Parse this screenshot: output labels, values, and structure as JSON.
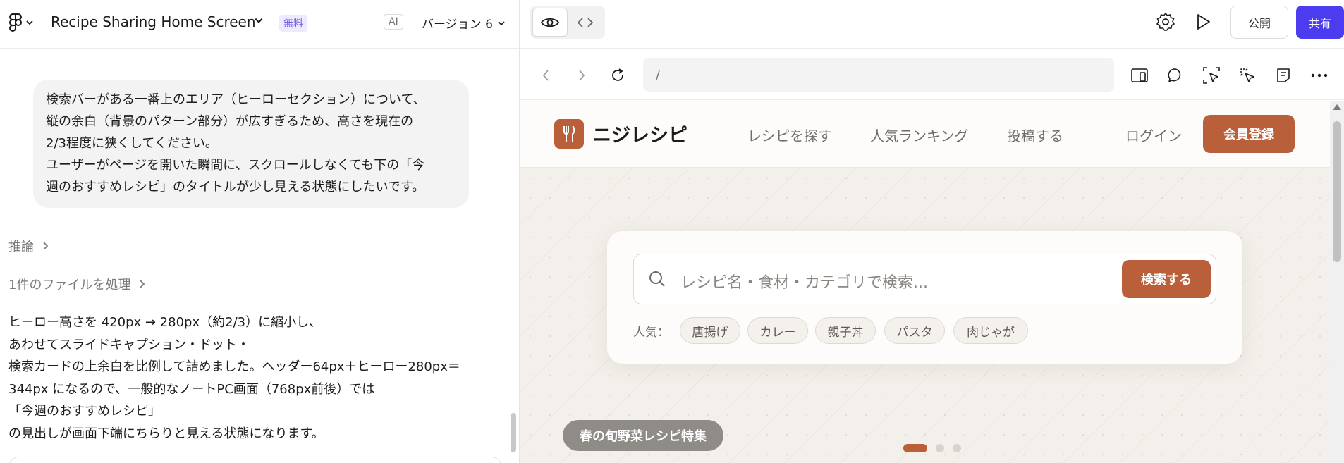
{
  "left_panel": {
    "project_title": "Recipe Sharing Home Screen",
    "plan_badge": "無料",
    "ai_badge": "AI",
    "version_label": "バージョン 6",
    "user_message": "検索バーがある一番上のエリア（ヒーローセクション）について、\n縦の余白（背景のパターン部分）が広すぎるため、高さを現在の\n2/3程度に狭くしてください。\nユーザーがページを開いた瞬間に、スクロールしなくても下の「今\n週のおすすめレシピ」のタイトルが少し見える状態にしたいです。",
    "reasoning_label": "推論",
    "files_processed_label": "1件のファイルを処理",
    "answer_lines": [
      "ヒーロー高さを 420px → 280px（約2/3）に縮小し、",
      "あわせてスライドキャプション・ドット・",
      "検索カードの上余白を比例して詰めました。ヘッダー64px＋ヒーロー280px＝",
      "344px になるので、一般的なノートPC画面（768px前後）では",
      "「今週のおすすめレシピ」",
      "の見出しが画面下端にちらりと見える状態になります。"
    ]
  },
  "toolbar": {
    "publish_label": "公開",
    "share_label": "共有"
  },
  "browser": {
    "url": "/"
  },
  "site": {
    "name": "ニジレシピ",
    "nav": [
      "レシピを探す",
      "人気ランキング",
      "投稿する"
    ],
    "login_label": "ログイン",
    "register_label": "会員登録",
    "search_placeholder": "レシピ名・食材・カテゴリで検索...",
    "search_button": "検索する",
    "popular_label": "人気：",
    "popular_tags": [
      "唐揚げ",
      "カレー",
      "親子丼",
      "パスタ",
      "肉じゃが"
    ],
    "slide_caption": "春の旬野菜レシピ特集",
    "slide_count": 3,
    "active_slide": 1
  },
  "colors": {
    "brand": "#b9603b",
    "share_button": "#4b3cf0",
    "free_badge_text": "#6d5ae6"
  }
}
